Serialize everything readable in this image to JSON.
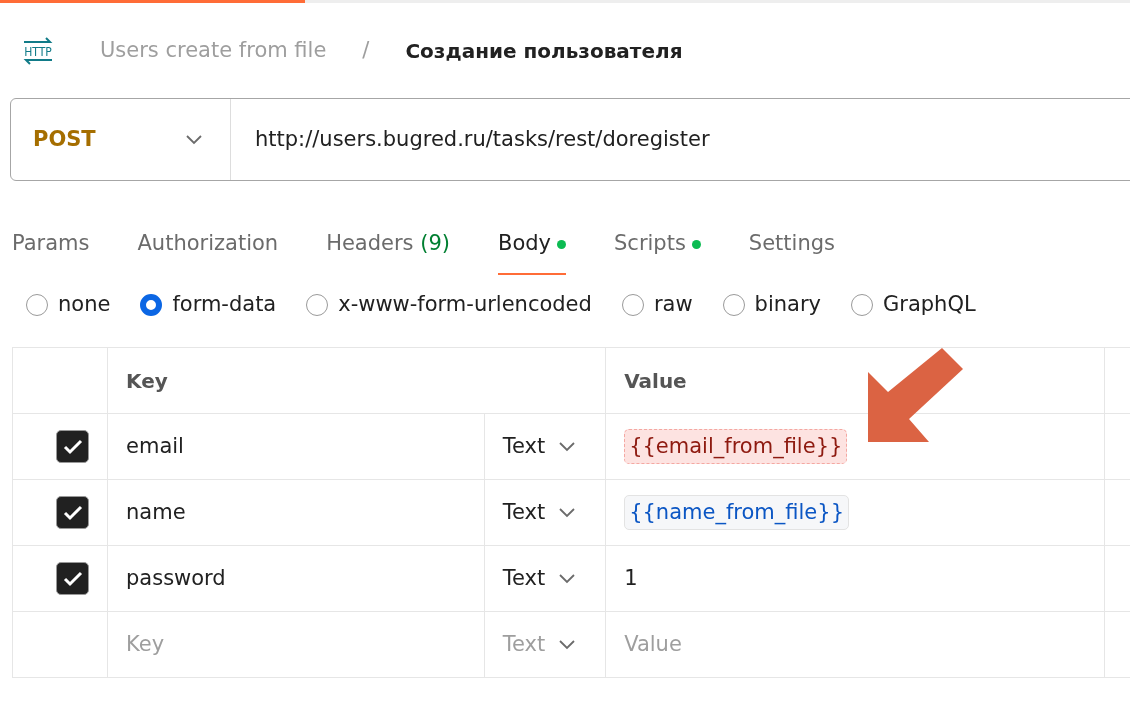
{
  "loading_bar": {
    "level": 0.27
  },
  "breadcrumb": {
    "icon_label": "HTTP",
    "collection": "Users create from file",
    "separator": "/",
    "request": "Создание пользователя"
  },
  "request": {
    "method": "POST",
    "url": "http://users.bugred.ru/tasks/rest/doregister"
  },
  "tabs": [
    {
      "label": "Params",
      "selected": false
    },
    {
      "label": "Authorization",
      "selected": false
    },
    {
      "label": "Headers",
      "count": "(9)",
      "selected": false
    },
    {
      "label": "Body",
      "dot": true,
      "selected": true
    },
    {
      "label": "Scripts",
      "dot": true,
      "selected": false
    },
    {
      "label": "Settings",
      "selected": false
    }
  ],
  "body_types": [
    {
      "label": "none",
      "selected": false
    },
    {
      "label": "form-data",
      "selected": true
    },
    {
      "label": "x-www-form-urlencoded",
      "selected": false
    },
    {
      "label": "raw",
      "selected": false
    },
    {
      "label": "binary",
      "selected": false
    },
    {
      "label": "GraphQL",
      "selected": false
    }
  ],
  "table": {
    "columns": [
      "Key",
      "Value"
    ],
    "rows": [
      {
        "checked": true,
        "key": "email",
        "type": "Text",
        "value": "{{email_from_file}}",
        "kind": "unresolved_variable"
      },
      {
        "checked": true,
        "key": "name",
        "type": "Text",
        "value": "{{name_from_file}}",
        "kind": "variable"
      },
      {
        "checked": true,
        "key": "password",
        "type": "Text",
        "value": "1",
        "kind": "plain"
      }
    ],
    "new_row": {
      "key_placeholder": "Key",
      "type": "Text",
      "value_placeholder": "Value"
    }
  }
}
